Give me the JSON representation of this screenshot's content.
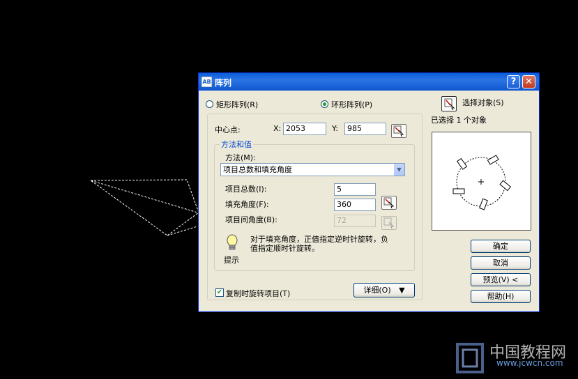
{
  "dialog": {
    "title": "阵列",
    "title_icon": "array-icon",
    "help_label": "?",
    "close_label": "✕"
  },
  "array_type": {
    "rect_label": "矩形阵列(R)",
    "polar_label": "环形阵列(P)",
    "selected": "polar"
  },
  "center": {
    "label": "中心点:",
    "x_label": "X:",
    "x_value": "2053",
    "y_label": "Y:",
    "y_value": "985"
  },
  "method_group": {
    "title": "方法和值",
    "method_label": "方法(M):",
    "method_value": "项目总数和填充角度",
    "total_label": "项目总数(I):",
    "total_value": "5",
    "fill_label": "填充角度(F):",
    "fill_value": "360",
    "between_label": "项目间角度(B):",
    "between_value": "72"
  },
  "tip": {
    "text_line1": "对于填充角度，正值指定逆时针旋转，负",
    "text_line2": "值指定顺时针旋转。",
    "label": "提示"
  },
  "rotate_copy": {
    "label": "复制时旋转项目(T)",
    "checked": true
  },
  "details_button": "详细(O)",
  "details_glyph": "▼",
  "select_objects": {
    "label": "选择对象(S)",
    "status": "已选择 1 个对象"
  },
  "buttons": {
    "ok": "确定",
    "cancel": "取消",
    "preview": "预览(V) <",
    "help": "帮助(H)"
  },
  "watermark": {
    "text_cn": "中国教程网",
    "text_url": "www.jcwcn.com"
  },
  "colors": {
    "title_bar": "#0a5fd8",
    "group_title": "#0046d5",
    "dialog_bg": "#ece9d8"
  }
}
